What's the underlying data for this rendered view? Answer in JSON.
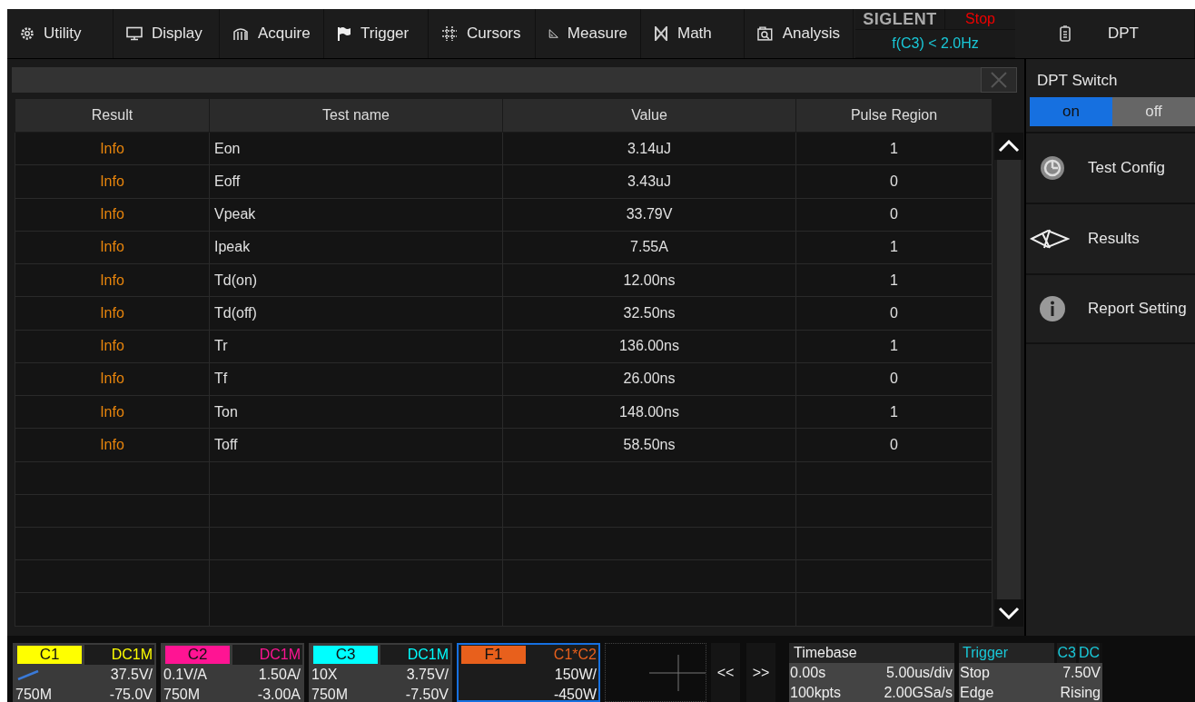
{
  "menu": [
    {
      "label": "Utility"
    },
    {
      "label": "Display"
    },
    {
      "label": "Acquire"
    },
    {
      "label": "Trigger"
    },
    {
      "label": "Cursors"
    },
    {
      "label": "Measure"
    },
    {
      "label": "Math"
    },
    {
      "label": "Analysis"
    }
  ],
  "status": {
    "brand": "SIGLENT",
    "run_state": "Stop",
    "trigger_info": "f(C3) < 2.0Hz"
  },
  "dpt_menu": {
    "label": "DPT"
  },
  "table": {
    "columns": [
      "Result",
      "Test name",
      "Value",
      "Pulse Region"
    ],
    "rows": [
      {
        "result": "Info",
        "test_name": "Eon",
        "value": "3.14uJ",
        "pulse_region": "1"
      },
      {
        "result": "Info",
        "test_name": "Eoff",
        "value": "3.43uJ",
        "pulse_region": "0"
      },
      {
        "result": "Info",
        "test_name": "Vpeak",
        "value": "33.79V",
        "pulse_region": "0"
      },
      {
        "result": "Info",
        "test_name": "Ipeak",
        "value": "7.55A",
        "pulse_region": "1"
      },
      {
        "result": "Info",
        "test_name": "Td(on)",
        "value": "12.00ns",
        "pulse_region": "1"
      },
      {
        "result": "Info",
        "test_name": "Td(off)",
        "value": "32.50ns",
        "pulse_region": "0"
      },
      {
        "result": "Info",
        "test_name": "Tr",
        "value": "136.00ns",
        "pulse_region": "1"
      },
      {
        "result": "Info",
        "test_name": "Tf",
        "value": "26.00ns",
        "pulse_region": "0"
      },
      {
        "result": "Info",
        "test_name": "Ton",
        "value": "148.00ns",
        "pulse_region": "1"
      },
      {
        "result": "Info",
        "test_name": "Toff",
        "value": "58.50ns",
        "pulse_region": "0"
      }
    ]
  },
  "panel": {
    "switch_label": "DPT Switch",
    "switch_options": [
      {
        "label": "on",
        "selected": true
      },
      {
        "label": "off",
        "selected": false
      }
    ],
    "items": [
      {
        "label": "Test Config"
      },
      {
        "label": "Results"
      },
      {
        "label": "Report Setting"
      }
    ]
  },
  "channels": [
    {
      "name": "C1",
      "color": "#ffff00",
      "coupling": "DC1M",
      "row2_right": "37.5V/",
      "row3_left": "750M",
      "row3_right": "-75.0V",
      "selected": false
    },
    {
      "name": "C2",
      "color": "#ff1493",
      "coupling": "DC1M",
      "row2_left": "0.1V/A",
      "row2_right": "1.50A/",
      "row3_left": "750M",
      "row3_right": "-3.00A",
      "selected": false
    },
    {
      "name": "C3",
      "color": "#00ffff",
      "coupling": "DC1M",
      "row2_left": "10X",
      "row2_right": "3.75V/",
      "row3_left": "750M",
      "row3_right": "-7.50V",
      "selected": false
    },
    {
      "name": "F1",
      "color": "#e8601c",
      "coupling": "C1*C2",
      "row2_right": "150W/",
      "row3_right": "-450W",
      "selected": true
    }
  ],
  "nav": [
    "<<",
    ">>"
  ],
  "timebase": {
    "title": "Timebase",
    "delay": "0.00s",
    "scale": "5.00us/div",
    "depth": "100kpts",
    "rate": "2.00GSa/s"
  },
  "trigger": {
    "title": "Trigger",
    "source": "C3",
    "coupling": "DC",
    "state": "Stop",
    "level": "7.50V",
    "type": "Edge",
    "slope": "Rising"
  }
}
